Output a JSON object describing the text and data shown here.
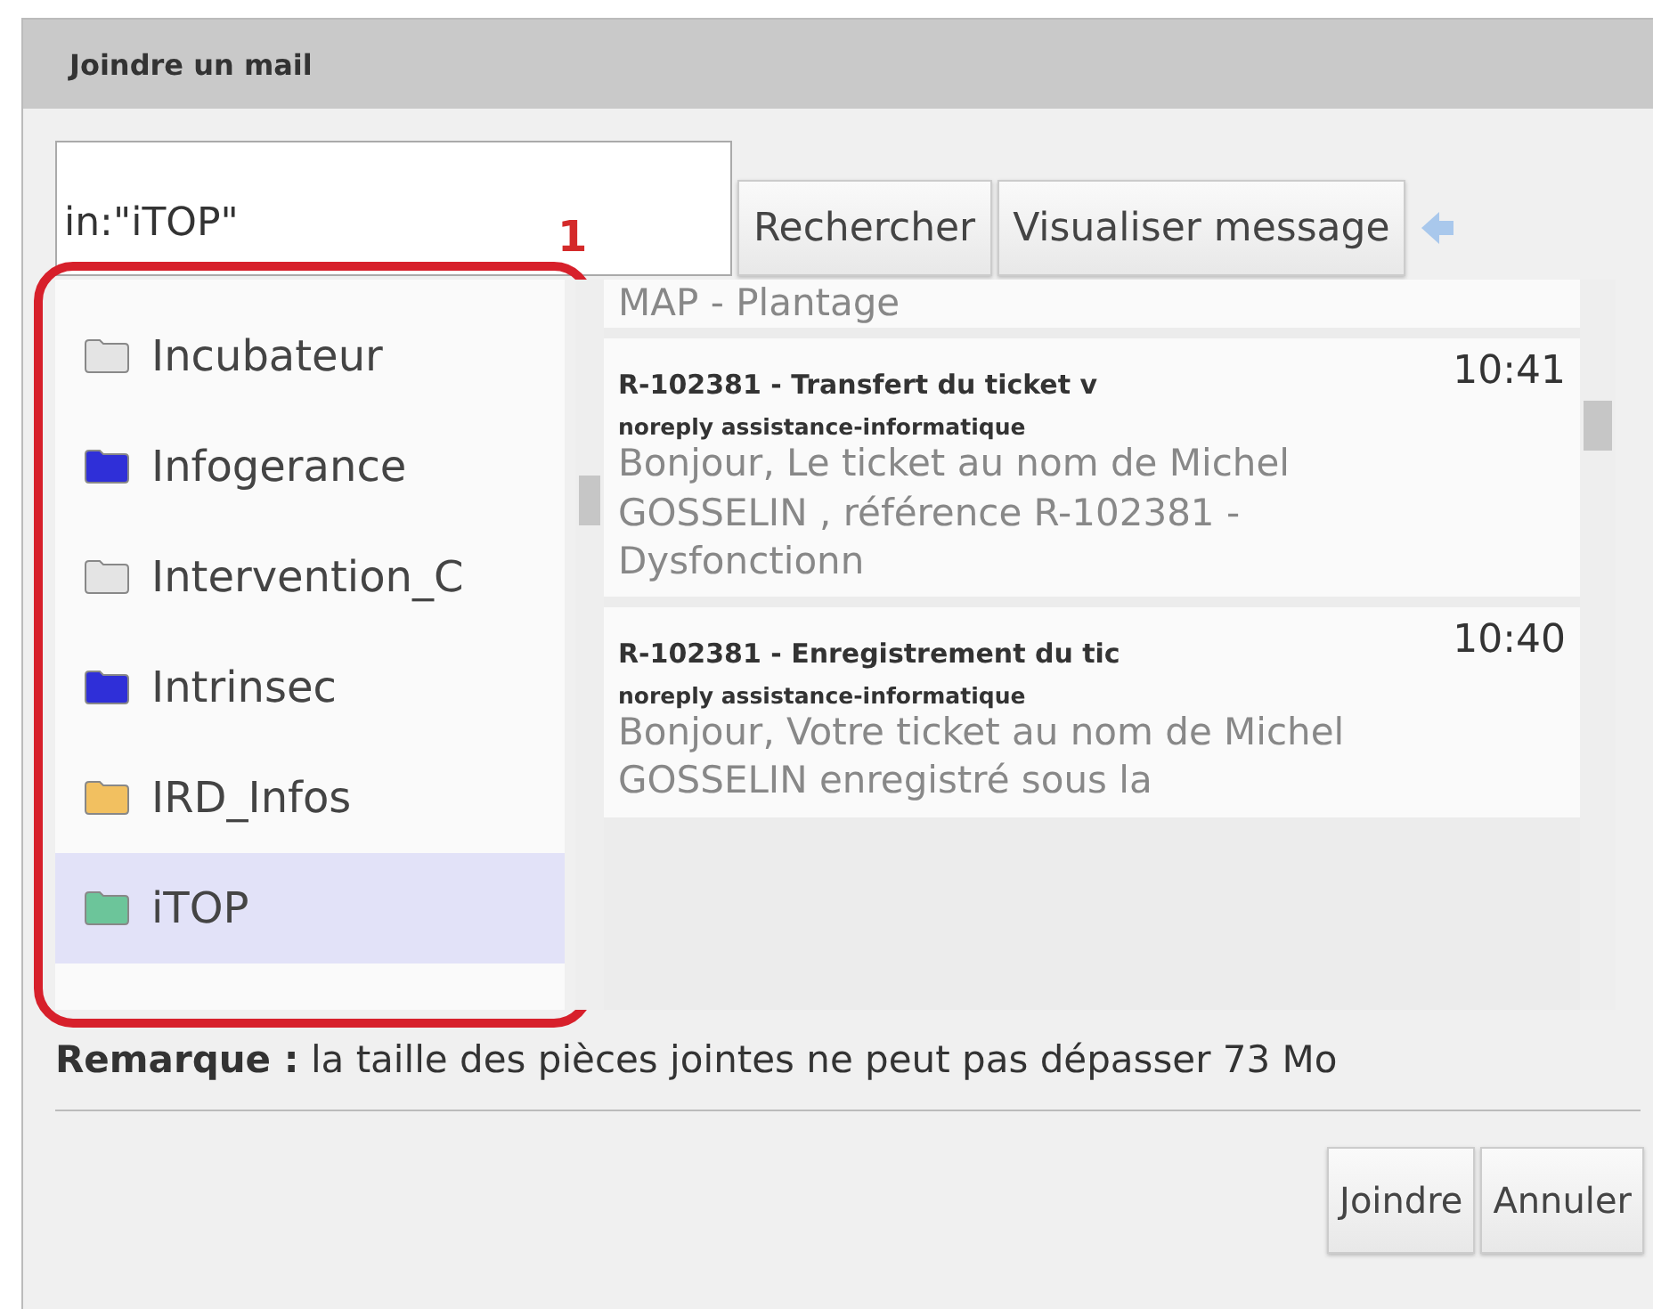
{
  "window": {
    "title": "Joindre un mail"
  },
  "search": {
    "value": "in:\"iTOP\""
  },
  "toolbar": [
    {
      "label": "Rechercher"
    },
    {
      "label": "Visualiser message"
    }
  ],
  "annotation": {
    "label": "1"
  },
  "folders": [
    {
      "name": "Incubateur",
      "color": "#e4e4e4",
      "selected": false
    },
    {
      "name": "Infogerance",
      "color": "#2f2fd8",
      "selected": false
    },
    {
      "name": "Intervention_C",
      "color": "#e4e4e4",
      "selected": false
    },
    {
      "name": "Intrinsec",
      "color": "#2f2fd8",
      "selected": false
    },
    {
      "name": "IRD_Infos",
      "color": "#f2c060",
      "selected": false
    },
    {
      "name": "iTOP",
      "color": "#6cc59a",
      "selected": true
    }
  ],
  "messages": [
    {
      "kind": "partial",
      "preview": "MAP - Plantage"
    },
    {
      "kind": "full",
      "subject": "R-102381 - Transfert du ticket v",
      "time": "10:41",
      "sender": "noreply assistance-informatique",
      "preview": "Bonjour, Le ticket au nom de Michel GOSSELIN , référence R-102381 - Dysfonctionn"
    },
    {
      "kind": "full",
      "subject": "R-102381 - Enregistrement du tic",
      "time": "10:40",
      "sender": "noreply assistance-informatique",
      "preview": "Bonjour, Votre ticket au nom de Michel GOSSELIN enregistré sous la"
    }
  ],
  "note": "**Remarque :** la taille des pièces jointes ne peut pas dépasser 73 Mo",
  "buttons": [
    {
      "label": "Joindre"
    },
    {
      "label": "Annuler"
    }
  ]
}
